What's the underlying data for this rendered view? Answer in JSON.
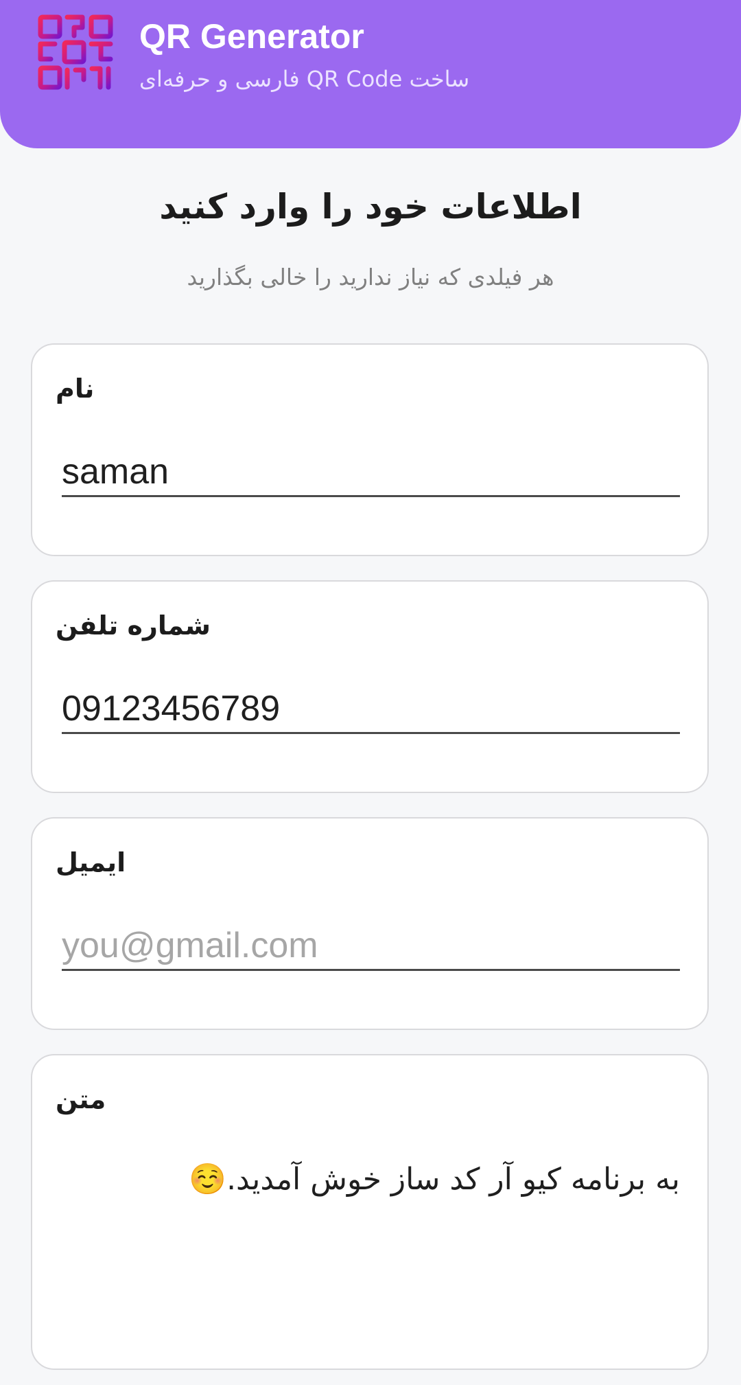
{
  "header": {
    "title": "QR Generator",
    "subtitle": "ساخت QR Code فارسی و حرفه‌ای",
    "logo_icon": "qr-logo-icon",
    "background_color": "#9b69f0"
  },
  "intro": {
    "title": "اطلاعات خود را وارد کنید",
    "subtitle": "هر فیلدی که نیاز ندارید را خالی بگذارید"
  },
  "form": {
    "name": {
      "label": "نام",
      "value": "saman"
    },
    "phone": {
      "label": "شماره تلفن",
      "value": "09123456789"
    },
    "email": {
      "label": "ایمیل",
      "value": "",
      "placeholder": "you@gmail.com"
    },
    "text": {
      "label": "متن",
      "value": "به برنامه کیو آر کد ساز خوش آمدید.☺️"
    }
  }
}
